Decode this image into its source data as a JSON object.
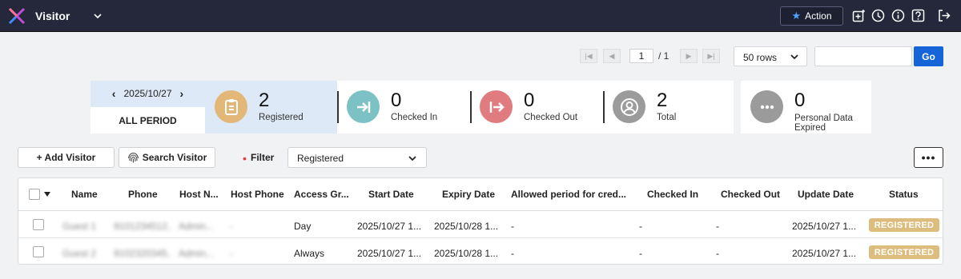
{
  "app": {
    "title": "Visitor",
    "action_label": "Action"
  },
  "pager": {
    "current_page": "1",
    "total": "/ 1",
    "rows_option": "50 rows",
    "go_label": "Go",
    "search_value": ""
  },
  "summary": {
    "date": "2025/10/27",
    "period_label": "ALL PERIOD",
    "stats": [
      {
        "count": "2",
        "label": "Registered",
        "color": "#e3b778",
        "icon": "clipboard-icon"
      },
      {
        "count": "0",
        "label": "Checked In",
        "color": "#7cc2c4",
        "icon": "check-in-icon"
      },
      {
        "count": "0",
        "label": "Checked Out",
        "color": "#e07b80",
        "icon": "check-out-icon"
      },
      {
        "count": "2",
        "label": "Total",
        "color": "#9b9b9b",
        "icon": "person-icon"
      },
      {
        "count": "0",
        "label": "Personal Data Expired",
        "color": "#9b9b9b",
        "icon": "ellipsis-icon"
      }
    ]
  },
  "toolbar": {
    "add_visitor": "+ Add Visitor",
    "search_visitor": "Search Visitor",
    "filter_label": "Filter",
    "filter_value": "Registered",
    "more_label": "•••"
  },
  "table": {
    "headers": [
      "Name",
      "Phone",
      "Host N...",
      "Host Phone",
      "Access Gr...",
      "Start Date",
      "Expiry Date",
      "Allowed period for cred...",
      "Checked In",
      "Checked Out",
      "Update Date",
      "Status"
    ],
    "rows": [
      {
        "name": "Guest 1",
        "phone": "9101234512...",
        "host": "Admin...",
        "host_phone": "-",
        "access": "Day",
        "start": "2025/10/27 1...",
        "expiry": "2025/10/28 1...",
        "allowed": "-",
        "checked_in": "-",
        "checked_out": "-",
        "update": "2025/10/27 1...",
        "status": "REGISTERED"
      },
      {
        "name": "Guest 2",
        "phone": "9102320345...",
        "host": "Admin...",
        "host_phone": "-",
        "access": "Always",
        "start": "2025/10/27 1...",
        "expiry": "2025/10/28 1...",
        "allowed": "-",
        "checked_in": "-",
        "checked_out": "-",
        "update": "2025/10/27 1...",
        "status": "REGISTERED"
      }
    ]
  },
  "colors": {
    "topbar": "#24283a",
    "accent": "#1565d8",
    "status_badge": "#ddbd7e",
    "active_panel": "#dde9f6"
  }
}
